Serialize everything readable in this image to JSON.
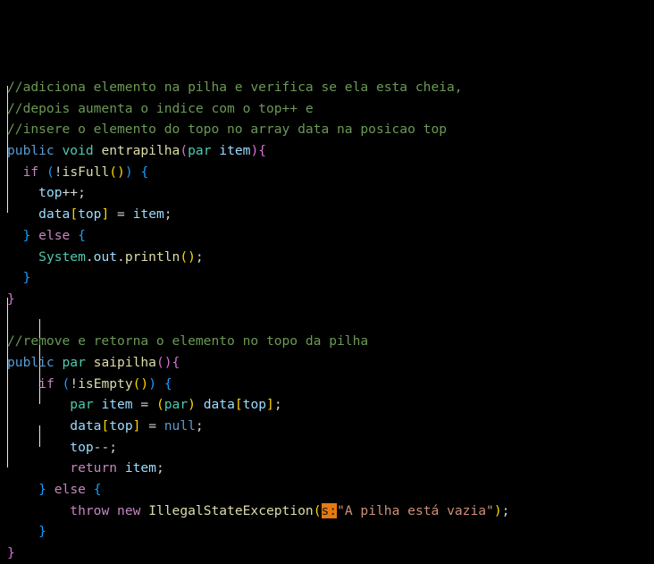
{
  "colors": {
    "comment": "#6a9955",
    "kw": "#569cd6",
    "ctrl": "#c586c0",
    "type": "#4ec9b0",
    "fn": "#dcdcaa",
    "var": "#9cdcfe",
    "str": "#ce9178",
    "punc": "#d4d4d4",
    "b1": "#da70d6",
    "b2": "#179fff",
    "b3": "#ffd700",
    "hint": "#1a1a1a"
  },
  "code_lines": [
    [
      {
        "t": "//adiciona elemento na pilha e verifica se ela esta cheia,",
        "c": "comment"
      }
    ],
    [
      {
        "t": "//depois aumenta o indice com o top++ e",
        "c": "comment"
      }
    ],
    [
      {
        "t": "//insere o elemento do topo no array data na posicao top",
        "c": "comment"
      }
    ],
    [
      {
        "t": "public",
        "c": "kw"
      },
      {
        "t": " ",
        "c": "punc"
      },
      {
        "t": "void",
        "c": "type"
      },
      {
        "t": " ",
        "c": "punc"
      },
      {
        "t": "entrapilha",
        "c": "fn"
      },
      {
        "t": "(",
        "c": "b1"
      },
      {
        "t": "par",
        "c": "type"
      },
      {
        "t": " ",
        "c": "punc"
      },
      {
        "t": "item",
        "c": "var"
      },
      {
        "t": ")",
        "c": "b1"
      },
      {
        "t": "{",
        "c": "b1"
      }
    ],
    [
      {
        "t": "  ",
        "c": "punc"
      },
      {
        "t": "if",
        "c": "ctrl"
      },
      {
        "t": " ",
        "c": "punc"
      },
      {
        "t": "(",
        "c": "b2"
      },
      {
        "t": "!",
        "c": "punc"
      },
      {
        "t": "isFull",
        "c": "fn"
      },
      {
        "t": "()",
        "c": "b3"
      },
      {
        "t": ")",
        "c": "b2"
      },
      {
        "t": " ",
        "c": "punc"
      },
      {
        "t": "{",
        "c": "b2"
      }
    ],
    [
      {
        "t": "    ",
        "c": "punc"
      },
      {
        "t": "top",
        "c": "var"
      },
      {
        "t": "++;",
        "c": "punc"
      }
    ],
    [
      {
        "t": "    ",
        "c": "punc"
      },
      {
        "t": "data",
        "c": "var"
      },
      {
        "t": "[",
        "c": "b3"
      },
      {
        "t": "top",
        "c": "var"
      },
      {
        "t": "]",
        "c": "b3"
      },
      {
        "t": " = ",
        "c": "punc"
      },
      {
        "t": "item",
        "c": "var"
      },
      {
        "t": ";",
        "c": "punc"
      }
    ],
    [
      {
        "t": "  ",
        "c": "punc"
      },
      {
        "t": "}",
        "c": "b2"
      },
      {
        "t": " ",
        "c": "punc"
      },
      {
        "t": "else",
        "c": "ctrl"
      },
      {
        "t": " ",
        "c": "punc"
      },
      {
        "t": "{",
        "c": "b2"
      }
    ],
    [
      {
        "t": "    ",
        "c": "punc"
      },
      {
        "t": "System",
        "c": "type"
      },
      {
        "t": ".",
        "c": "punc"
      },
      {
        "t": "out",
        "c": "var"
      },
      {
        "t": ".",
        "c": "punc"
      },
      {
        "t": "println",
        "c": "fn"
      },
      {
        "t": "()",
        "c": "b3"
      },
      {
        "t": ";",
        "c": "punc"
      }
    ],
    [
      {
        "t": "  ",
        "c": "punc"
      },
      {
        "t": "}",
        "c": "b2"
      }
    ],
    [
      {
        "t": "}",
        "c": "b1"
      }
    ],
    [],
    [
      {
        "t": "//remove e retorna o elemento no topo da pilha",
        "c": "comment"
      }
    ],
    [
      {
        "t": "public",
        "c": "kw"
      },
      {
        "t": " ",
        "c": "punc"
      },
      {
        "t": "par",
        "c": "type"
      },
      {
        "t": " ",
        "c": "punc"
      },
      {
        "t": "saipilha",
        "c": "fn"
      },
      {
        "t": "()",
        "c": "b1"
      },
      {
        "t": "{",
        "c": "b1"
      }
    ],
    [
      {
        "t": "    ",
        "c": "punc"
      },
      {
        "t": "if",
        "c": "ctrl"
      },
      {
        "t": " ",
        "c": "punc"
      },
      {
        "t": "(",
        "c": "b2"
      },
      {
        "t": "!",
        "c": "punc"
      },
      {
        "t": "isEmpty",
        "c": "fn"
      },
      {
        "t": "()",
        "c": "b3"
      },
      {
        "t": ")",
        "c": "b2"
      },
      {
        "t": " ",
        "c": "punc"
      },
      {
        "t": "{",
        "c": "b2"
      }
    ],
    [
      {
        "t": "        ",
        "c": "punc"
      },
      {
        "t": "par",
        "c": "type"
      },
      {
        "t": " ",
        "c": "punc"
      },
      {
        "t": "item",
        "c": "var"
      },
      {
        "t": " = ",
        "c": "punc"
      },
      {
        "t": "(",
        "c": "b3"
      },
      {
        "t": "par",
        "c": "type"
      },
      {
        "t": ")",
        "c": "b3"
      },
      {
        "t": " ",
        "c": "punc"
      },
      {
        "t": "data",
        "c": "var"
      },
      {
        "t": "[",
        "c": "b3"
      },
      {
        "t": "top",
        "c": "var"
      },
      {
        "t": "]",
        "c": "b3"
      },
      {
        "t": ";",
        "c": "punc"
      }
    ],
    [
      {
        "t": "        ",
        "c": "punc"
      },
      {
        "t": "data",
        "c": "var"
      },
      {
        "t": "[",
        "c": "b3"
      },
      {
        "t": "top",
        "c": "var"
      },
      {
        "t": "]",
        "c": "b3"
      },
      {
        "t": " = ",
        "c": "punc"
      },
      {
        "t": "null",
        "c": "kw"
      },
      {
        "t": ";",
        "c": "punc"
      }
    ],
    [
      {
        "t": "        ",
        "c": "punc"
      },
      {
        "t": "top",
        "c": "var"
      },
      {
        "t": "--;",
        "c": "punc"
      }
    ],
    [
      {
        "t": "        ",
        "c": "punc"
      },
      {
        "t": "return",
        "c": "ctrl"
      },
      {
        "t": " ",
        "c": "punc"
      },
      {
        "t": "item",
        "c": "var"
      },
      {
        "t": ";",
        "c": "punc"
      }
    ],
    [
      {
        "t": "    ",
        "c": "punc"
      },
      {
        "t": "}",
        "c": "b2"
      },
      {
        "t": " ",
        "c": "punc"
      },
      {
        "t": "else",
        "c": "ctrl"
      },
      {
        "t": " ",
        "c": "punc"
      },
      {
        "t": "{",
        "c": "b2"
      }
    ],
    [
      {
        "t": "        ",
        "c": "punc"
      },
      {
        "t": "throw",
        "c": "ctrl"
      },
      {
        "t": " ",
        "c": "punc"
      },
      {
        "t": "new",
        "c": "ctrl"
      },
      {
        "t": " ",
        "c": "punc"
      },
      {
        "t": "IllegalStateException",
        "c": "fn"
      },
      {
        "t": "(",
        "c": "b3"
      },
      {
        "t": "s:",
        "c": "hint"
      },
      {
        "t": "\"A pilha está vazia\"",
        "c": "str"
      },
      {
        "t": ")",
        "c": "b3"
      },
      {
        "t": ";",
        "c": "punc"
      }
    ],
    [
      {
        "t": "    ",
        "c": "punc"
      },
      {
        "t": "}",
        "c": "b2"
      }
    ],
    [
      {
        "t": "}",
        "c": "b1"
      }
    ]
  ]
}
